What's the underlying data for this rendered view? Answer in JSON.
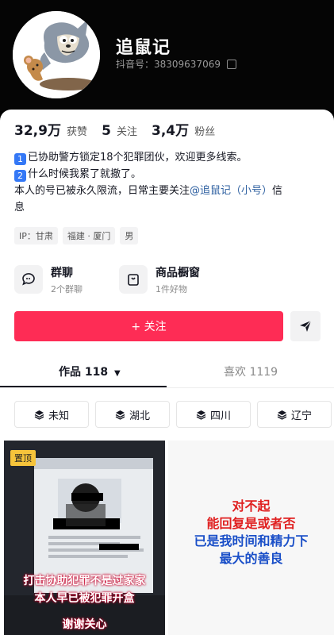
{
  "profile": {
    "name": "追鼠记",
    "douyin_id": "抖音号：38309637069",
    "avatar_icon": "cartoon-cat-mouse-avatar"
  },
  "stats": [
    {
      "value": "32,9万",
      "label": "获赞"
    },
    {
      "value": "5",
      "label": "关注"
    },
    {
      "value": "3,4万",
      "label": "粉丝"
    }
  ],
  "bio": {
    "line1_badge": "1",
    "line1": "已协助警方锁定18个犯罪团伙，欢迎更多线索。",
    "line2_badge": "2",
    "line2": "什么时候我累了就撤了。",
    "line3_prefix": "本人的号已被永久限流，日常主要关注",
    "line3_link": "@追鼠记（小号）",
    "line3_suffix": "信",
    "line4": "息"
  },
  "tags": [
    "IP：甘肃",
    "福建 · 厦门",
    "男"
  ],
  "entries": {
    "group_chat": {
      "title": "群聊",
      "subtitle": "2个群聊",
      "icon": "chat-bubble-icon"
    },
    "shop": {
      "title": "商品橱窗",
      "subtitle": "1件好物",
      "icon": "shopping-bag-icon"
    }
  },
  "actions": {
    "follow_label": "+ 关注",
    "share_icon": "send-icon"
  },
  "tabs": {
    "works_label": "作品 118",
    "likes_label": "喜欢 1119"
  },
  "filters": [
    "未知",
    "湖北",
    "四川",
    "辽宁"
  ],
  "videos": [
    {
      "pinned_label": "置顶",
      "overlay_lines": [
        "打击协助犯罪不是过家家",
        "本人早已被犯罪开盒",
        "谢谢关心"
      ]
    },
    {
      "overlay_lines": [
        "对不起",
        "能回复是或者否",
        "已是我时间和精力下",
        "最大的善良"
      ]
    }
  ],
  "colors": {
    "accent": "#fe2c55",
    "link": "#2d5fa0",
    "badge": "#3478f6",
    "pinned": "#f6c43b"
  }
}
